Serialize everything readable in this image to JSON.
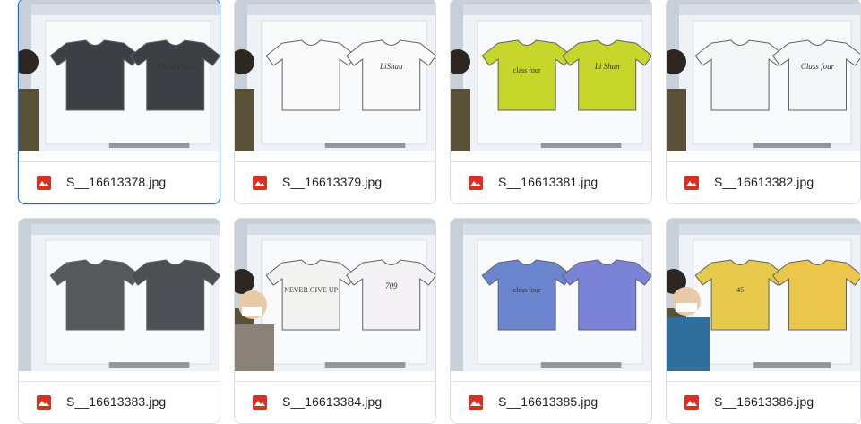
{
  "files": [
    {
      "name": "S__16613378.jpg",
      "selected": true,
      "shirt_left": "#3e3f44",
      "shirt_right": "#3e3f44",
      "left_text": "",
      "right_text": "Clase Four"
    },
    {
      "name": "S__16613379.jpg",
      "selected": false,
      "shirt_left": "#fafafa",
      "shirt_right": "#fafafa",
      "left_text": "",
      "right_text": "LiShau"
    },
    {
      "name": "S__16613381.jpg",
      "selected": false,
      "shirt_left": "#c7d62a",
      "shirt_right": "#c7d62a",
      "left_text": "class four",
      "right_text": "Li Shan"
    },
    {
      "name": "S__16613382.jpg",
      "selected": false,
      "shirt_left": "#f4f6f8",
      "shirt_right": "#f4f6f8",
      "left_text": "",
      "right_text": "Class four"
    },
    {
      "name": "S__16613383.jpg",
      "selected": false,
      "shirt_left": "#56585c",
      "shirt_right": "#4d4f54",
      "left_text": "",
      "right_text": ""
    },
    {
      "name": "S__16613384.jpg",
      "selected": false,
      "shirt_left": "#f2f2f0",
      "shirt_right": "#f4f2f4",
      "left_text": "NEVER GIVE UP",
      "right_text": "709"
    },
    {
      "name": "S__16613385.jpg",
      "selected": false,
      "shirt_left": "#6b86cf",
      "shirt_right": "#7b83d6",
      "left_text": "class four",
      "right_text": ""
    },
    {
      "name": "S__16613386.jpg",
      "selected": false,
      "shirt_left": "#e6c94a",
      "shirt_right": "#ecc64a",
      "left_text": "45",
      "right_text": ""
    }
  ],
  "icon_name": "image-file-icon",
  "accent": "#1a73e8",
  "file_icon_color": "#d93025"
}
